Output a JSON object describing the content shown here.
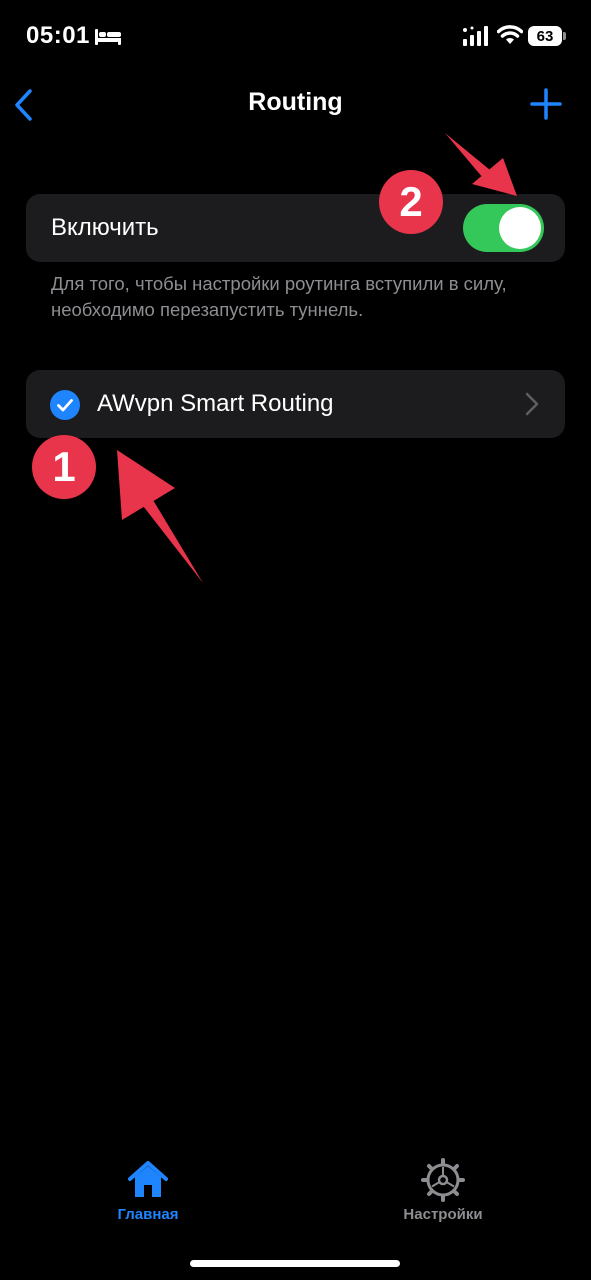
{
  "status_bar": {
    "time": "05:01",
    "battery": "63",
    "icons": [
      "bed-icon",
      "cellular-signal-icon",
      "wifi-icon",
      "battery-icon"
    ]
  },
  "nav": {
    "title": "Routing",
    "back_icon": "chevron-left-icon",
    "add_icon": "plus-icon"
  },
  "toggle": {
    "label": "Включить",
    "state": "on",
    "footnote": "Для того, чтобы настройки роутинга вступили в силу, необходимо перезапустить туннель."
  },
  "routes": [
    {
      "label": "AWvpn Smart Routing",
      "selected": true,
      "icon": "checkmark-circle-icon"
    }
  ],
  "annotations": {
    "badge_1": "1",
    "badge_2": "2"
  },
  "tabs": [
    {
      "label": "Главная",
      "icon": "house-icon",
      "active": true
    },
    {
      "label": "Настройки",
      "icon": "gear-icon",
      "active": false
    }
  ],
  "colors": {
    "accent": "#1e85ff",
    "toggle_on": "#34c759",
    "annotation": "#e8354b",
    "card_bg": "#1c1c1e"
  }
}
